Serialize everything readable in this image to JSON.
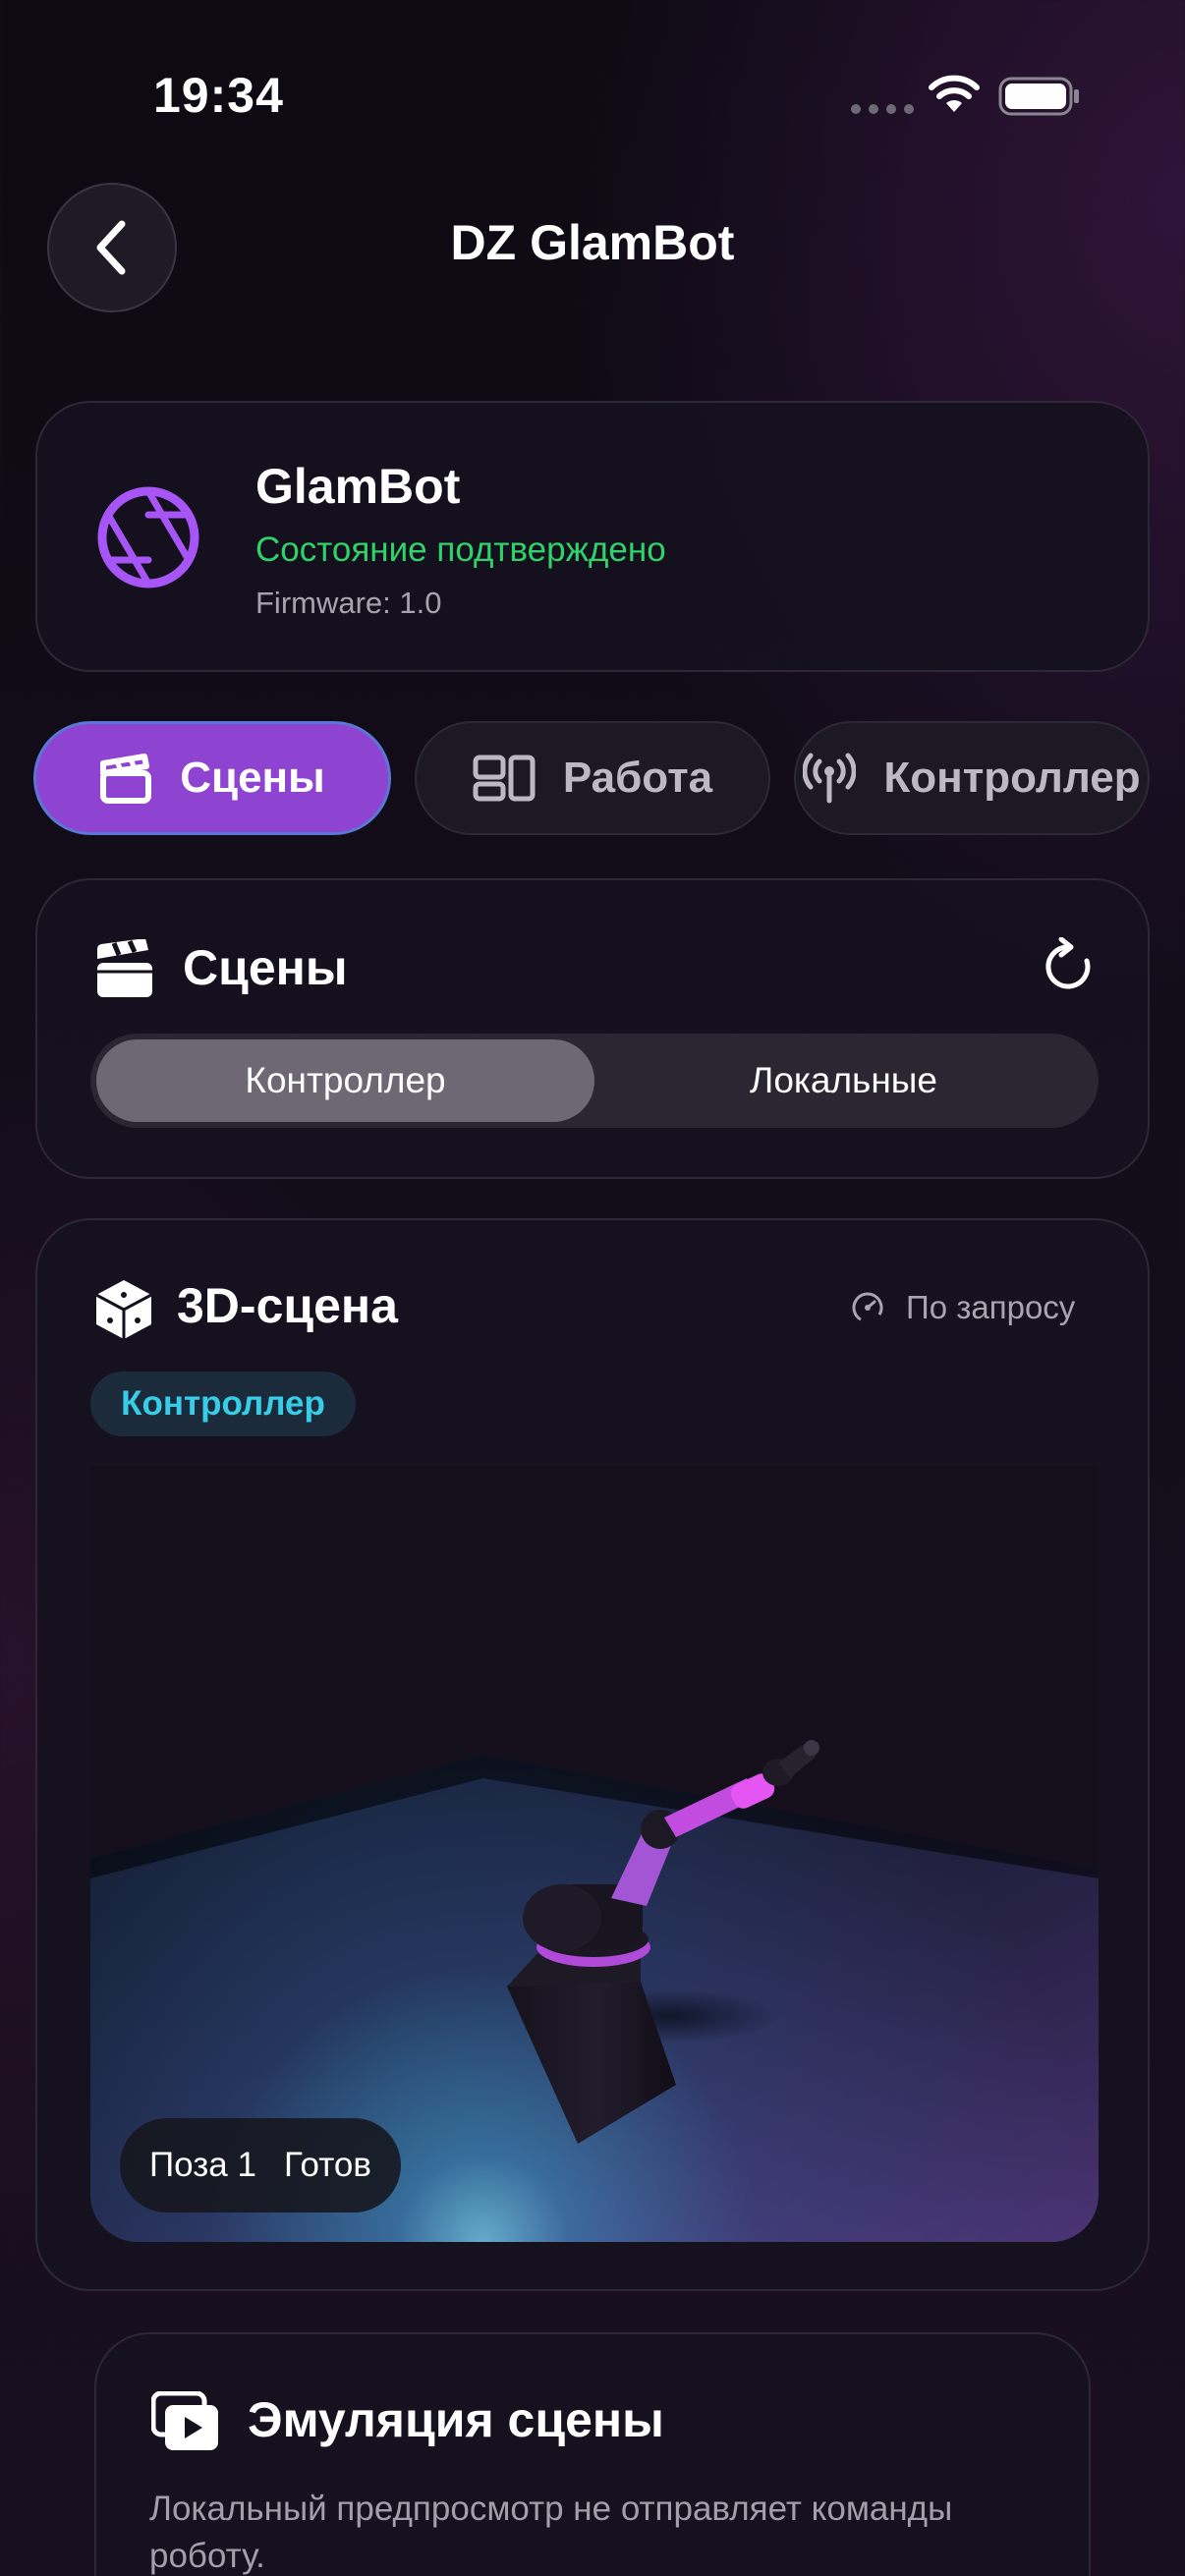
{
  "status_bar": {
    "time": "19:34"
  },
  "header": {
    "title": "DZ GlamBot"
  },
  "device": {
    "name": "GlamBot",
    "status": "Состояние подтверждено",
    "firmware": "Firmware: 1.0",
    "accent_color": "#a855f7",
    "status_color": "#2fd36a"
  },
  "tabs": [
    {
      "label": "Сцены",
      "icon": "clapperboard-icon",
      "active": true
    },
    {
      "label": "Работа",
      "icon": "layout-icon",
      "active": false
    },
    {
      "label": "Контроллер",
      "icon": "antenna-icon",
      "active": false
    }
  ],
  "scenes": {
    "title": "Сцены",
    "segments": [
      {
        "label": "Контроллер",
        "active": true
      },
      {
        "label": "Локальные",
        "active": false
      }
    ]
  },
  "scene3d": {
    "title": "3D-сцена",
    "mode": "По запросу",
    "source": "Контроллер",
    "pose": "Поза 1",
    "state": "Готов"
  },
  "emulation": {
    "title": "Эмуляция сцены",
    "description": "Локальный предпросмотр не отправляет команды роботу."
  }
}
